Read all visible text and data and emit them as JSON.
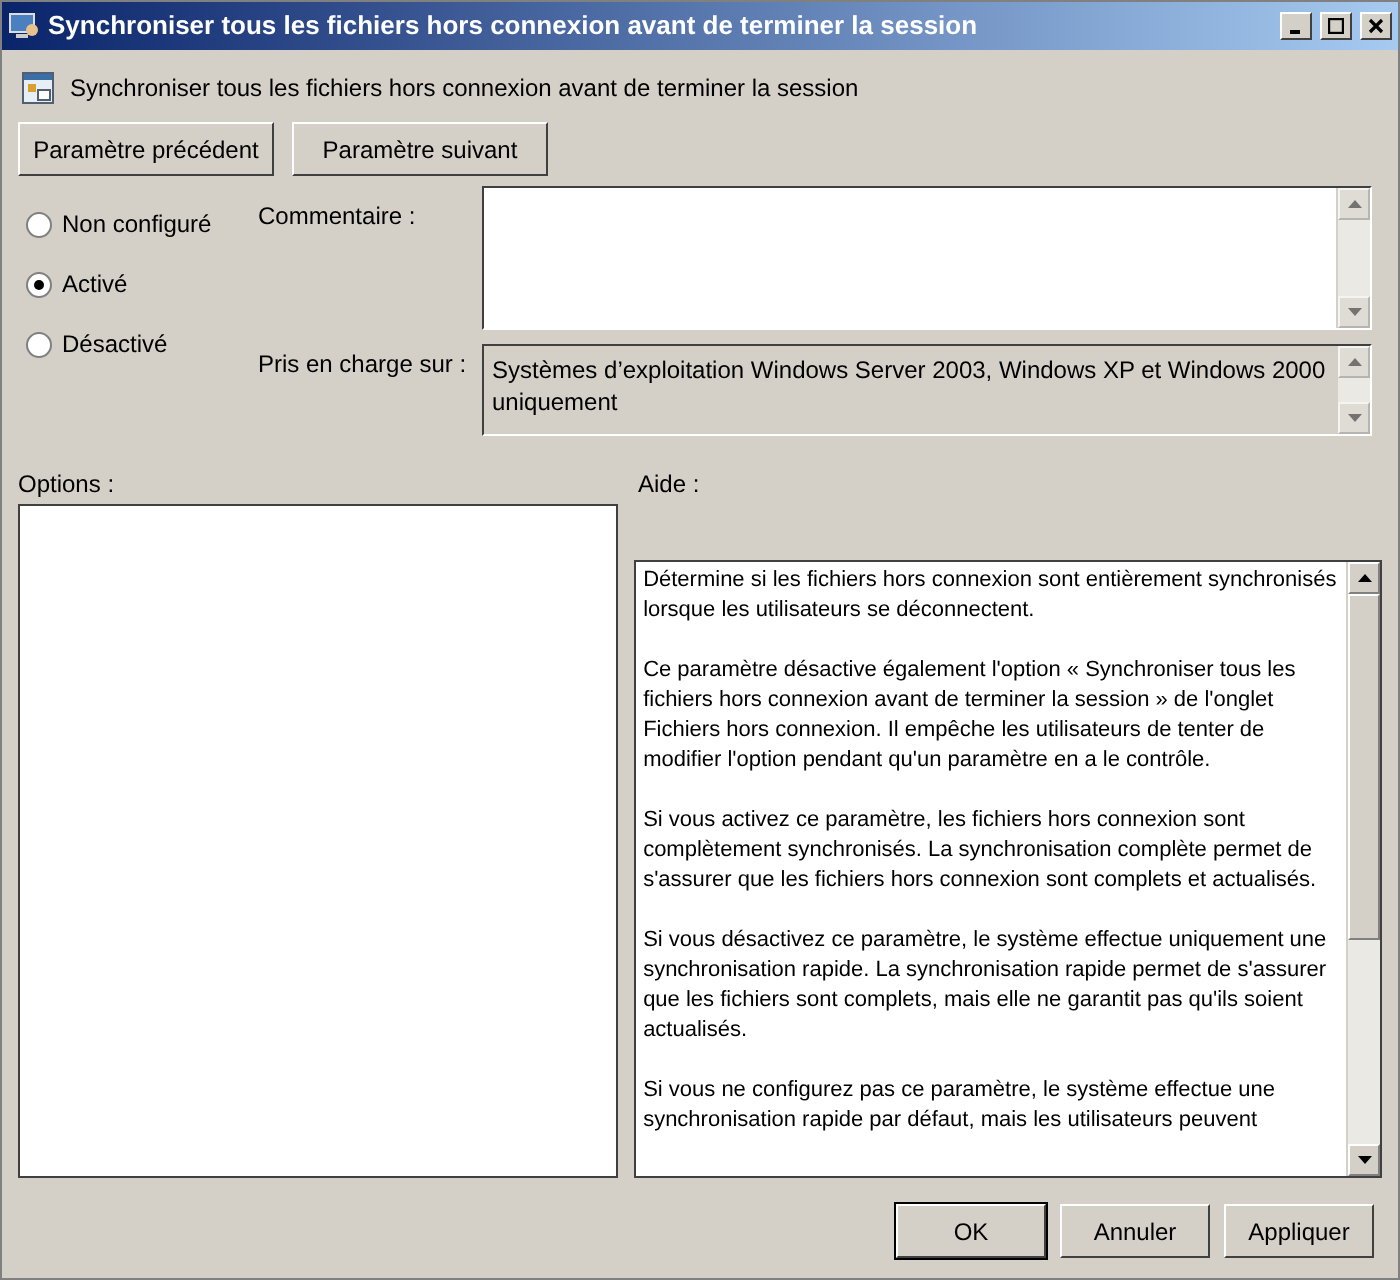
{
  "window": {
    "title": "Synchroniser tous les fichiers hors connexion avant de terminer la session"
  },
  "heading": "Synchroniser tous les fichiers hors connexion avant de terminer la session",
  "nav_buttons": [
    "Paramètre précédent",
    "Paramètre suivant"
  ],
  "radios": [
    {
      "label": "Non configuré",
      "selected": false
    },
    {
      "label": "Activé",
      "selected": true
    },
    {
      "label": "Désactivé",
      "selected": false
    }
  ],
  "comment": {
    "label": "Commentaire :"
  },
  "supported": {
    "label": "Pris en charge sur :",
    "value": "Systèmes d’exploitation Windows Server 2003, Windows XP et Windows 2000 uniquement"
  },
  "options": {
    "label": "Options :"
  },
  "help": {
    "label": "Aide :",
    "paragraphs": [
      "Détermine si les fichiers hors connexion sont entièrement synchronisés lorsque les utilisateurs se déconnectent.",
      "Ce paramètre désactive également l'option « Synchroniser tous les fichiers hors connexion avant de terminer la session » de l'onglet Fichiers hors connexion. Il empêche les utilisateurs de tenter de modifier l'option pendant qu'un paramètre en a le contrôle.",
      "Si vous activez ce paramètre, les fichiers hors connexion sont complètement synchronisés. La synchronisation complète permet de s'assurer que les fichiers hors connexion sont complets et actualisés.",
      "Si vous désactivez ce paramètre, le système effectue uniquement une synchronisation rapide. La synchronisation rapide permet de s'assurer que les fichiers sont complets, mais elle ne garantit pas qu'ils soient actualisés.",
      "Si vous ne configurez pas ce paramètre, le système effectue une synchronisation rapide par défaut, mais les utilisateurs peuvent"
    ]
  },
  "footer_buttons": [
    {
      "label": "OK",
      "default": true
    },
    {
      "label": "Annuler",
      "default": false
    },
    {
      "label": "Appliquer",
      "default": false
    }
  ]
}
